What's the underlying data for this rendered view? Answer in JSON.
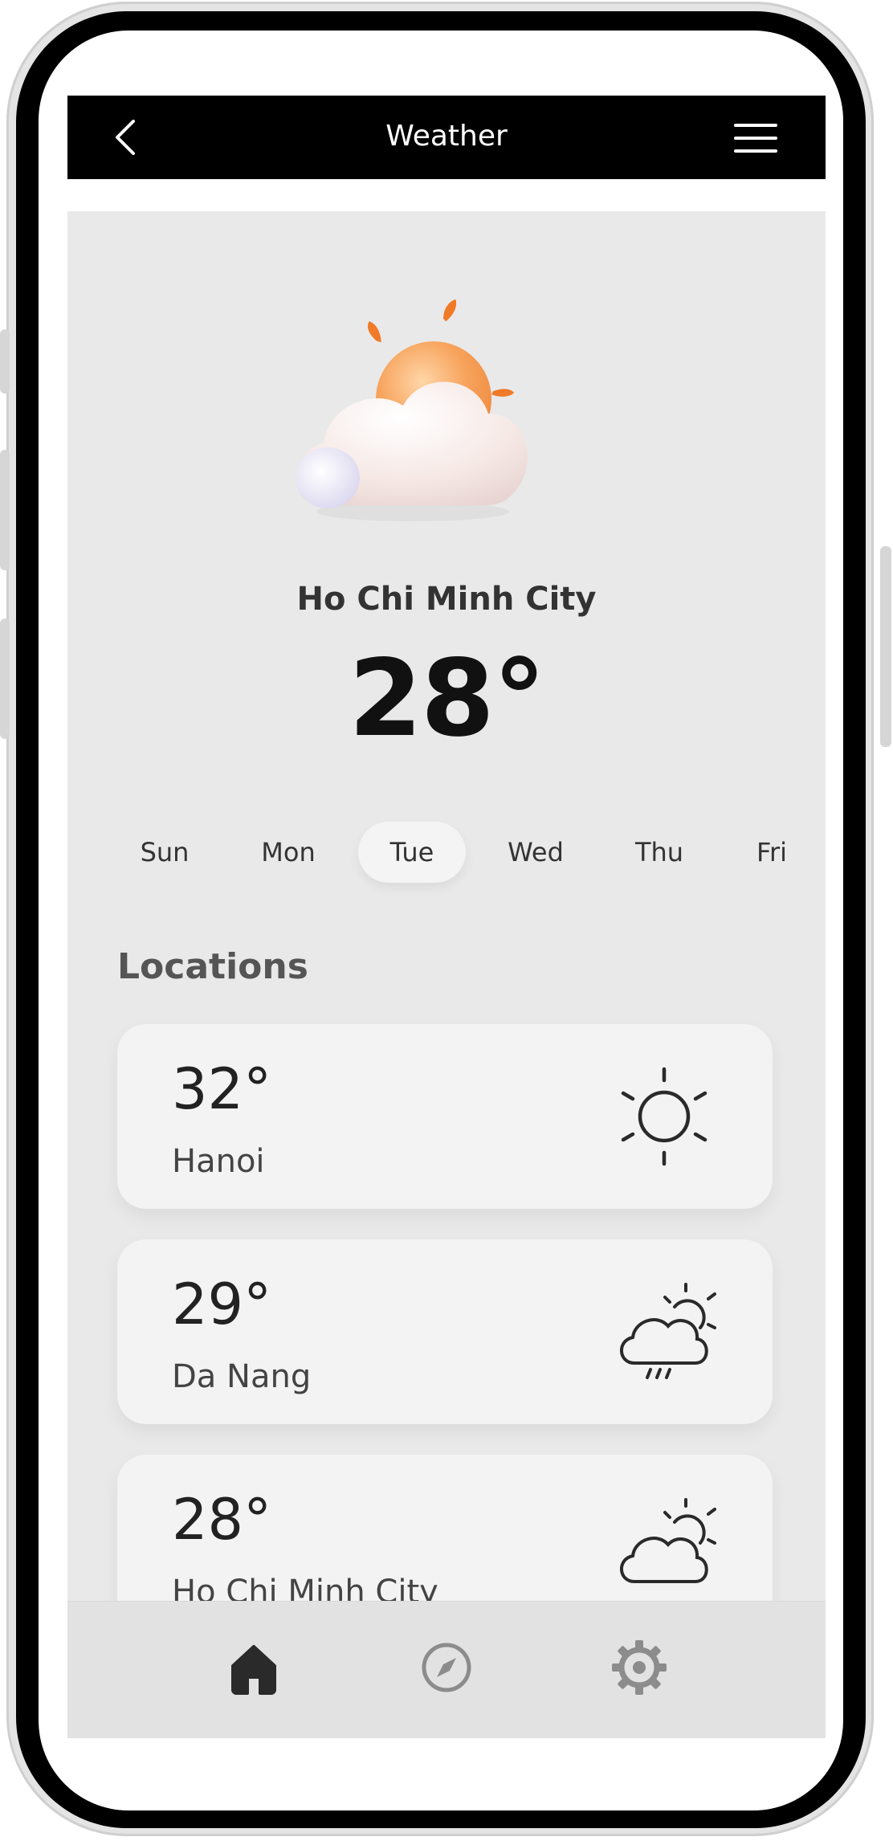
{
  "header": {
    "title": "Weather",
    "back_icon": "chevron-left-icon",
    "menu_icon": "hamburger-menu-icon"
  },
  "hero": {
    "icon": "partly-cloudy-3d-icon",
    "city": "Ho Chi Minh City",
    "temperature": "28°"
  },
  "days": {
    "items": [
      "Sun",
      "Mon",
      "Tue",
      "Wed",
      "Thu",
      "Fri"
    ],
    "selected": "Tue"
  },
  "locations": {
    "heading": "Locations",
    "items": [
      {
        "temperature": "32°",
        "city": "Hanoi",
        "icon": "sun-icon"
      },
      {
        "temperature": "29°",
        "city": "Da Nang",
        "icon": "cloud-sun-rain-icon"
      },
      {
        "temperature": "28°",
        "city": "Ho Chi Minh City",
        "icon": "cloud-sun-icon"
      }
    ]
  },
  "bottom_nav": {
    "items": [
      "home-icon",
      "compass-icon",
      "settings-gear-icon"
    ],
    "active": "home-icon"
  },
  "colors": {
    "topbar": "#000000",
    "background": "#e9e9e9",
    "card": "#f3f3f3",
    "sun": "#f5a05a",
    "sun_ray": "#f07a28",
    "text_dark": "#111111"
  }
}
